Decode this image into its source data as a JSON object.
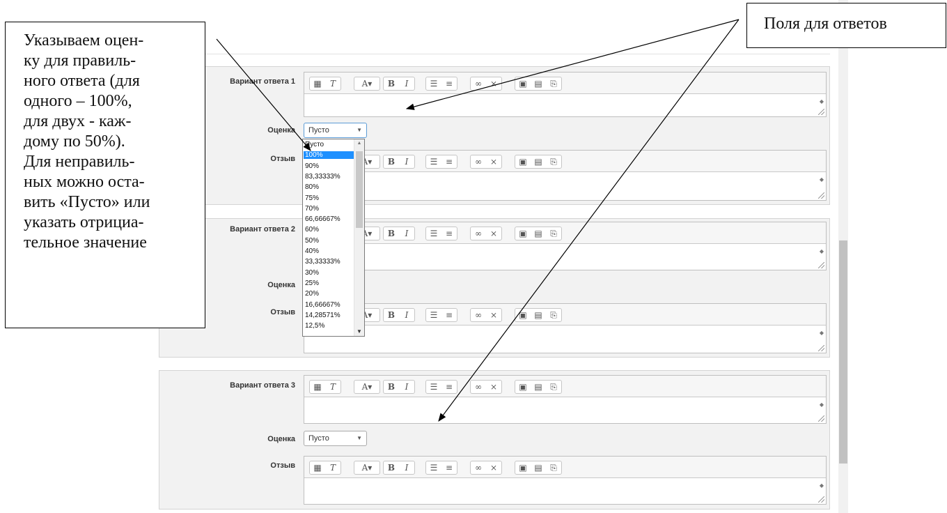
{
  "answer_blocks": [
    {
      "variant_label": "Вариант ответа 1",
      "grade_label": "Оценка",
      "grade_value": "Пусто",
      "feedback_label": "Отзыв"
    },
    {
      "variant_label": "Вариант ответа 2",
      "grade_label": "Оценка",
      "grade_value": "",
      "feedback_label": "Отзыв"
    },
    {
      "variant_label": "Вариант ответа 3",
      "grade_label": "Оценка",
      "grade_value": "Пусто",
      "feedback_label": "Отзыв"
    }
  ],
  "grade_dropdown": {
    "selected": "100%",
    "options": [
      "Пусто",
      "100%",
      "90%",
      "83,33333%",
      "80%",
      "75%",
      "70%",
      "66,66667%",
      "60%",
      "50%",
      "40%",
      "33,33333%",
      "30%",
      "25%",
      "20%",
      "16,66667%",
      "14,28571%",
      "12,5%"
    ]
  },
  "toolbar_icons": [
    "table-icon",
    "clear-format-icon",
    "font-color-icon",
    "bold-icon",
    "italic-icon",
    "bullet-list-icon",
    "numbered-list-icon",
    "link-icon",
    "unlink-icon",
    "image-icon",
    "media-icon",
    "paste-icon"
  ],
  "annotations": {
    "left_callout_lines": [
      "Указываем оцен-",
      "ку для правиль-",
      "ного ответа (для",
      "одного – 100%,",
      "для двух - каж-",
      "дому по 50%).",
      "Для неправиль-",
      "ных можно оста-",
      "вить «Пусто» или",
      "указать отрициа-",
      "тельное значение"
    ],
    "right_callout": "Поля для ответов"
  },
  "colors": {
    "dropdown_selection": "#1e90ff",
    "block_bg": "#f2f2f2"
  }
}
